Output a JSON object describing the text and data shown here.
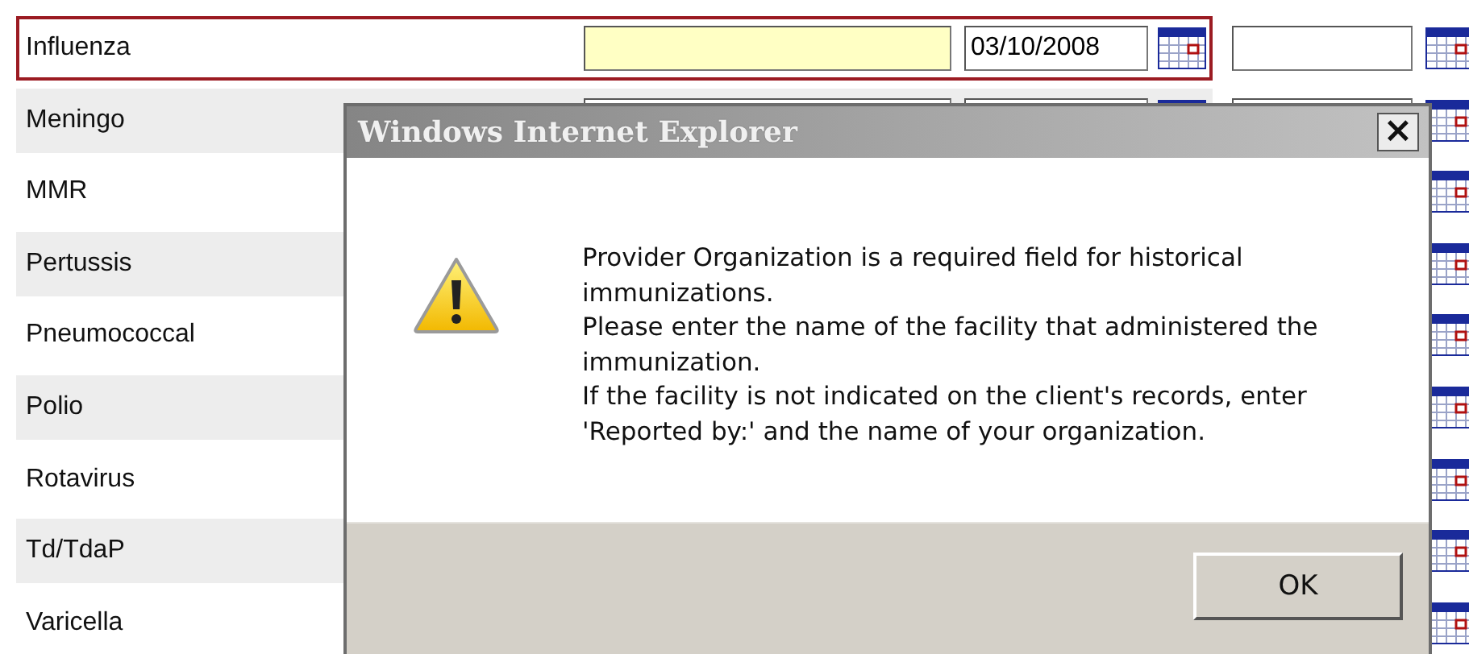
{
  "rows": [
    {
      "label": "Influenza",
      "selected": true,
      "provider_highlighted": true,
      "date": "03/10/2008"
    },
    {
      "label": "Meningo",
      "selected": false,
      "provider_highlighted": false
    },
    {
      "label": "MMR",
      "selected": false
    },
    {
      "label": "Pertussis",
      "selected": false
    },
    {
      "label": "Pneumococcal",
      "selected": false
    },
    {
      "label": "Polio",
      "selected": false
    },
    {
      "label": "Rotavirus",
      "selected": false
    },
    {
      "label": "Td/TdaP",
      "selected": false
    },
    {
      "label": "Varicella",
      "selected": false
    }
  ],
  "dialog": {
    "title": "Windows Internet Explorer",
    "close": "×",
    "message": [
      "Provider Organization is a required field for historical immunizations.",
      "Please enter the name of the facility that administered the immunization.",
      "If the facility is not indicated on the client's records, enter 'Reported by:' and the name of your organization."
    ],
    "buttons": [
      "OK"
    ]
  }
}
